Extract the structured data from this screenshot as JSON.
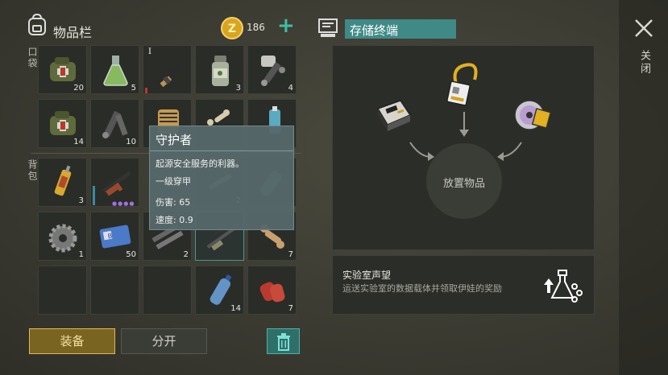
{
  "inventory": {
    "title": "物品栏",
    "currency_icon": "gold-coin-icon",
    "currency_amount": "186",
    "add_label": "+",
    "pocket_label": "口袋",
    "backpack_label": "背包"
  },
  "slots": {
    "r1c1": {
      "icon": "first-aid-bag-icon",
      "count": "20"
    },
    "r1c2": {
      "icon": "flask-icon",
      "count": "5"
    },
    "r1c3": {
      "icon": "rifle-icon",
      "count": "",
      "roman": "I"
    },
    "r1c4": {
      "icon": "pill-bottle-icon",
      "count": "3"
    },
    "r1c5": {
      "icon": "pipe-wrench-icon",
      "count": "4"
    },
    "r2c1": {
      "icon": "first-aid-bag-icon",
      "count": "14"
    },
    "r2c2": {
      "icon": "pipe-parts-icon",
      "count": "10"
    },
    "r2c3": {
      "icon": "filter-icon",
      "count": ""
    },
    "r2c4": {
      "icon": "bones-icon",
      "count": ""
    },
    "r2c5": {
      "icon": "spray-can-icon",
      "count": ""
    },
    "r3c1": {
      "icon": "syringe-icon",
      "count": "3"
    },
    "r3c2": {
      "icon": "assault-rifle-icon",
      "count": ""
    },
    "r3c4": {
      "icon": "tools-icon",
      "count": "2"
    },
    "r3c5": {
      "icon": "bottle-icon",
      "count": ""
    },
    "r4c1": {
      "icon": "gear-icon",
      "count": "1"
    },
    "r4c2": {
      "icon": "keycard-icon",
      "count": "50"
    },
    "r4c3": {
      "icon": "pipes-icon",
      "count": "2"
    },
    "r4c4": {
      "icon": "sniper-rifle-icon",
      "count": ""
    },
    "r4c5": {
      "icon": "bone-icon",
      "count": "7"
    },
    "r5c4": {
      "icon": "water-bottle-icon",
      "count": "14"
    },
    "r5c5": {
      "icon": "raw-meat-icon",
      "count": "7"
    }
  },
  "tooltip": {
    "name": "守护者",
    "desc": "起源安全服务的利器。",
    "armor": "一级穿甲",
    "damage": "伤害: 65",
    "speed": "速度: 0.9"
  },
  "buttons": {
    "equip": "装备",
    "split": "分开",
    "trash_icon": "trash-icon"
  },
  "terminal": {
    "title": "存储终端",
    "place_item": "放置物品",
    "close_label": "关闭",
    "close_icon": "close-icon"
  },
  "lab": {
    "title": "实验室声望",
    "desc": "运送实验室的数据载体并领取伊娃的奖励"
  },
  "colors": {
    "accent_gold": "#e2b84a",
    "teal": "#3f8a86",
    "panel": "#2b2d28"
  }
}
